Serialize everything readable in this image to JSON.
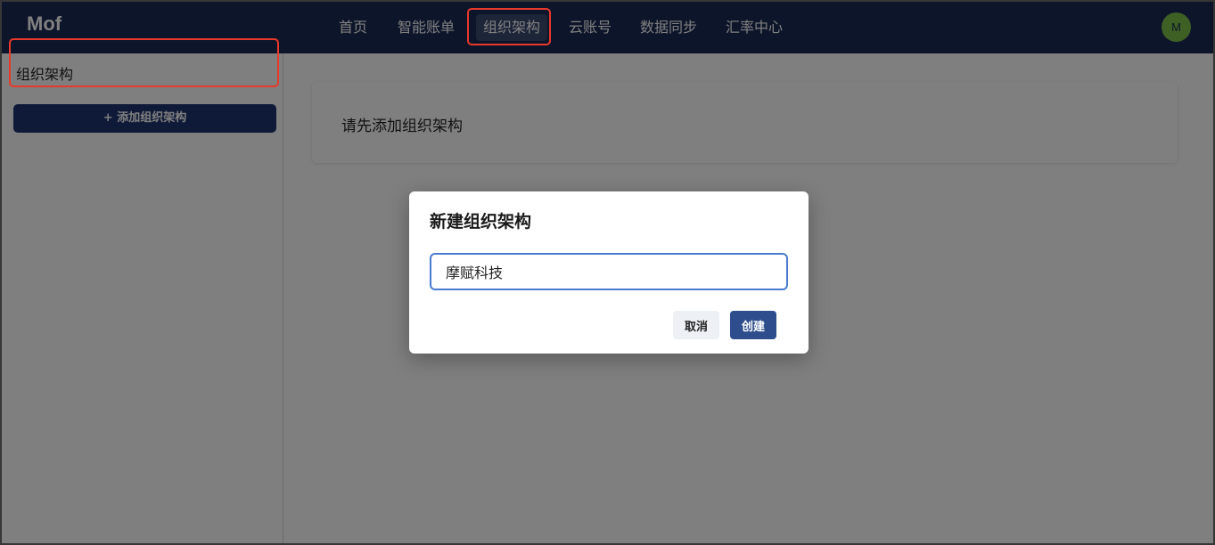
{
  "header": {
    "brand": "Mof",
    "nav": [
      {
        "label": "首页"
      },
      {
        "label": "智能账单"
      },
      {
        "label": "组织架构",
        "active": true
      },
      {
        "label": "云账号"
      },
      {
        "label": "数据同步"
      },
      {
        "label": "汇率中心"
      }
    ],
    "avatar_initial": "M"
  },
  "sidebar": {
    "title": "组织架构",
    "add_button_label": "+ 添加组织架构"
  },
  "main": {
    "empty_text": "请先添加组织架构"
  },
  "dialog": {
    "title": "新建组织架构",
    "input_value": "摩赋科技",
    "cancel_label": "取消",
    "create_label": "创建"
  },
  "colors": {
    "header_bg": "#1b2a55",
    "highlight": "#e8392a",
    "primary_button": "#1f3570",
    "avatar_bg": "#7cc04b"
  }
}
